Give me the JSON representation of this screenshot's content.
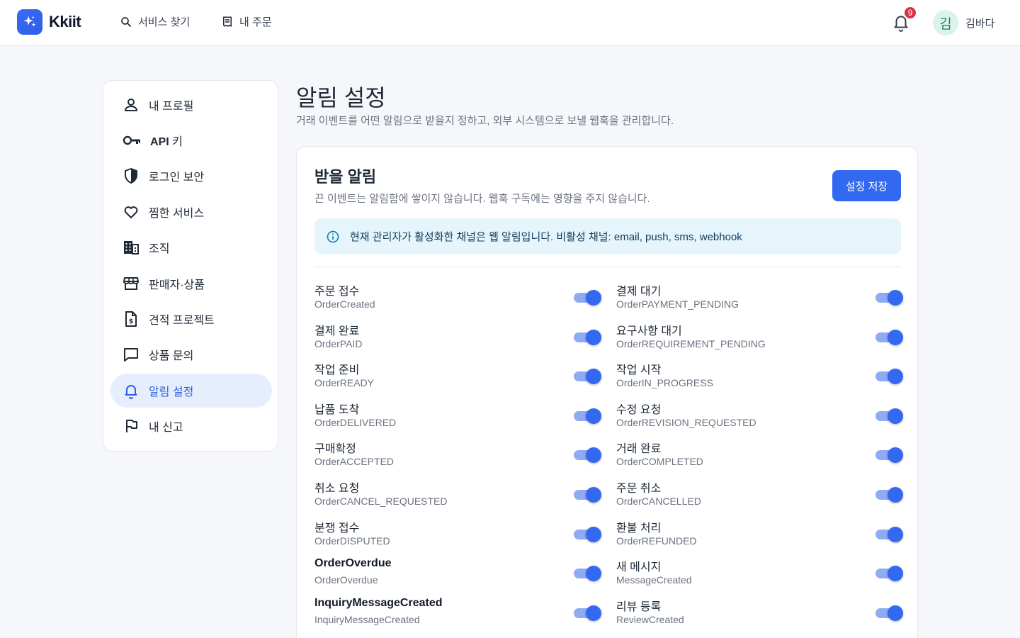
{
  "header": {
    "brand": "Kkiit",
    "nav": [
      {
        "label": "서비스 찾기",
        "icon": "search-icon"
      },
      {
        "label": "내 주문",
        "icon": "receipt-icon"
      }
    ],
    "notification_count": "9",
    "avatar_initial": "김",
    "user_name": "김바다"
  },
  "sidebar": {
    "items": [
      {
        "label": "내 프로필",
        "icon": "user-icon"
      },
      {
        "label_bold": "API",
        "label": " 키",
        "icon": "key-icon"
      },
      {
        "label": "로그인 보안",
        "icon": "shield-icon"
      },
      {
        "label": "찜한 서비스",
        "icon": "heart-icon"
      },
      {
        "label": "조직",
        "icon": "building-icon"
      },
      {
        "label": "판매자·상품",
        "icon": "store-icon"
      },
      {
        "label": "견적 프로젝트",
        "icon": "quote-document-icon"
      },
      {
        "label": "상품 문의",
        "icon": "chat-icon"
      },
      {
        "label": "알림 설정",
        "icon": "bell-icon",
        "active": true
      },
      {
        "label": "내 신고",
        "icon": "flag-icon"
      }
    ]
  },
  "page": {
    "title": "알림 설정",
    "subtitle": "거래 이벤트를 어떤 알림으로 받을지 정하고, 외부 시스템으로 보낼 웹훅을 관리합니다."
  },
  "card": {
    "title": "받을 알림",
    "subtitle": "끈 이벤트는 알림함에 쌓이지 않습니다. 웹훅 구독에는 영향을 주지 않습니다.",
    "save_label": "설정 저장",
    "info": "현재 관리자가 활성화한 채널은 웹 알림입니다. 비활성 채널: email, push, sms, webhook"
  },
  "events": [
    {
      "title": "주문 접수",
      "code": "OrderCreated",
      "enabled": true
    },
    {
      "title": "결제 대기",
      "code": "OrderPAYMENT_PENDING",
      "enabled": true
    },
    {
      "title": "결제 완료",
      "code": "OrderPAID",
      "enabled": true
    },
    {
      "title": "요구사항 대기",
      "code": "OrderREQUIREMENT_PENDING",
      "enabled": true
    },
    {
      "title": "작업 준비",
      "code": "OrderREADY",
      "enabled": true
    },
    {
      "title": "작업 시작",
      "code": "OrderIN_PROGRESS",
      "enabled": true
    },
    {
      "title": "납품 도착",
      "code": "OrderDELIVERED",
      "enabled": true
    },
    {
      "title": "수정 요청",
      "code": "OrderREVISION_REQUESTED",
      "enabled": true
    },
    {
      "title": "구매확정",
      "code": "OrderACCEPTED",
      "enabled": true
    },
    {
      "title": "거래 완료",
      "code": "OrderCOMPLETED",
      "enabled": true
    },
    {
      "title": "취소 요청",
      "code": "OrderCANCEL_REQUESTED",
      "enabled": true
    },
    {
      "title": "주문 취소",
      "code": "OrderCANCELLED",
      "enabled": true
    },
    {
      "title": "분쟁 접수",
      "code": "OrderDISPUTED",
      "enabled": true
    },
    {
      "title": "환불 처리",
      "code": "OrderREFUNDED",
      "enabled": true
    },
    {
      "title": "OrderOverdue",
      "code": "OrderOverdue",
      "enabled": true,
      "bold": true
    },
    {
      "title": "새 메시지",
      "code": "MessageCreated",
      "enabled": true
    },
    {
      "title": "InquiryMessageCreated",
      "code": "InquiryMessageCreated",
      "enabled": true,
      "bold": true
    },
    {
      "title": "리뷰 등록",
      "code": "ReviewCreated",
      "enabled": true
    }
  ],
  "colors": {
    "accent": "#3369f0",
    "active_bg": "#e6eefe",
    "badge": "#dc2f43",
    "info_bg": "#e6f5fb"
  }
}
